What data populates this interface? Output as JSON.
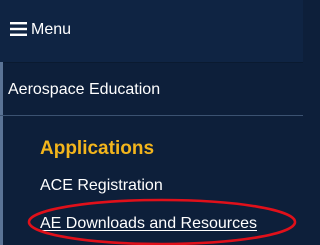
{
  "header": {
    "menu_label": "Menu",
    "icon": "hamburger-menu-icon"
  },
  "section": {
    "label": "Aerospace Education"
  },
  "submenu": {
    "heading": "Applications",
    "items": [
      {
        "label": "ACE Registration"
      },
      {
        "label": "AE Downloads and Resources"
      }
    ]
  },
  "annotation": {
    "type": "circled-highlight",
    "color": "#e0101a",
    "target": "AE Downloads and Resources"
  },
  "colors": {
    "background": "#0d1f3a",
    "header_bg": "#0f2443",
    "accent": "#f3b51c",
    "text": "#ffffff",
    "divider": "#3b5271"
  }
}
